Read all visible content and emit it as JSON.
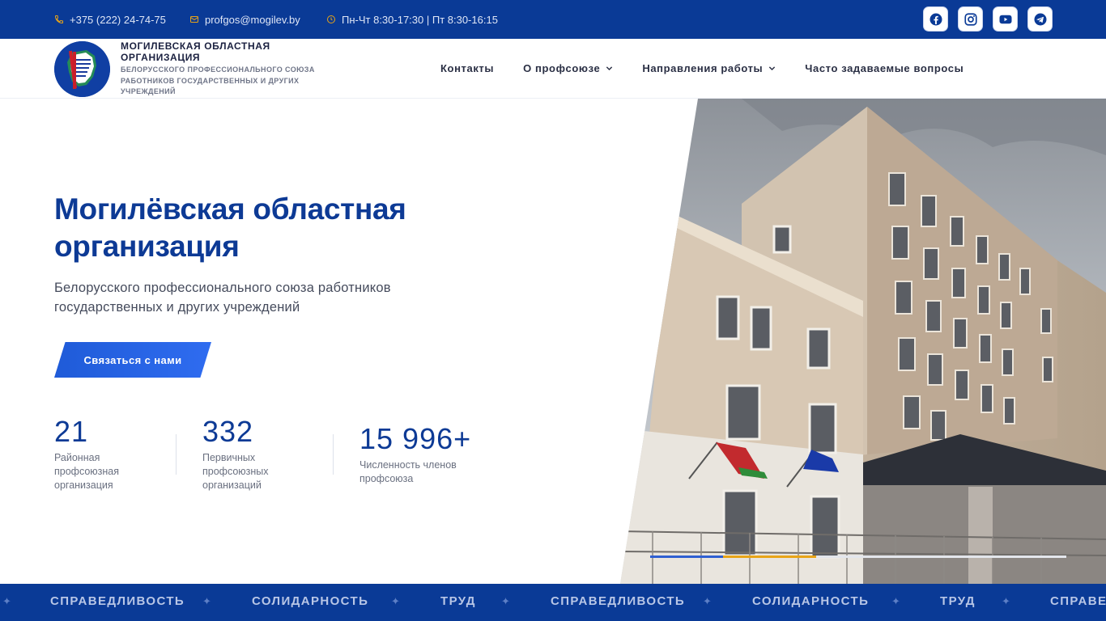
{
  "topbar": {
    "phone": "+375 (222) 24-74-75",
    "email": "profgos@mogilev.by",
    "hours": "Пн-Чт 8:30-17:30 | Пт 8:30-16:15",
    "socials": [
      "facebook-icon",
      "instagram-icon",
      "youtube-icon",
      "telegram-icon"
    ]
  },
  "header": {
    "brand_title": "МОГИЛЕВСКАЯ ОБЛАСТНАЯ ОРГАНИЗАЦИЯ",
    "brand_subtitle": "БЕЛОРУССКОГО ПРОФЕССИОНАЛЬНОГО СОЮЗА РАБОТНИКОВ ГОСУДАРСТВЕННЫХ И ДРУГИХ УЧРЕЖДЕНИЙ",
    "nav": [
      {
        "label": "Контакты",
        "has_dropdown": false
      },
      {
        "label": "О профсоюзе",
        "has_dropdown": true
      },
      {
        "label": "Направления работы",
        "has_dropdown": true
      },
      {
        "label": "Часто задаваемые вопросы",
        "has_dropdown": false
      }
    ]
  },
  "hero": {
    "title_line1": "Могилёвская областная",
    "title_line2": "организация",
    "subtitle_line1": "Белорусского профессионального союза работников",
    "subtitle_line2": "государственных и других учреждений",
    "cta_label": "Связаться с нами"
  },
  "stats": [
    {
      "value": "21",
      "label_lines": [
        "Районная",
        "профсоюзная",
        "организация"
      ]
    },
    {
      "value": "332",
      "label_lines": [
        "Первичных",
        "профсоюзных",
        "организаций"
      ]
    },
    {
      "value": "15 996+",
      "label_lines": [
        "Численность членов",
        "профсоюза"
      ]
    }
  ],
  "slider": {
    "progress_segments": 3,
    "active_segment": 1
  },
  "ribbon": {
    "words": [
      "СПРАВЕДЛИВОСТЬ",
      "СОЛИДАРНОСТЬ",
      "ТРУД",
      "СПРАВЕДЛИВОСТЬ",
      "СОЛИДАРНОСТЬ",
      "ТРУД",
      "СПРАВЕДЛИВОСТЬ"
    ],
    "separator": "✦"
  },
  "colors": {
    "primary": "#0a3a96",
    "heading": "#0d3a95",
    "cta": "#2563eb",
    "accent_yellow": "#e8a417"
  }
}
